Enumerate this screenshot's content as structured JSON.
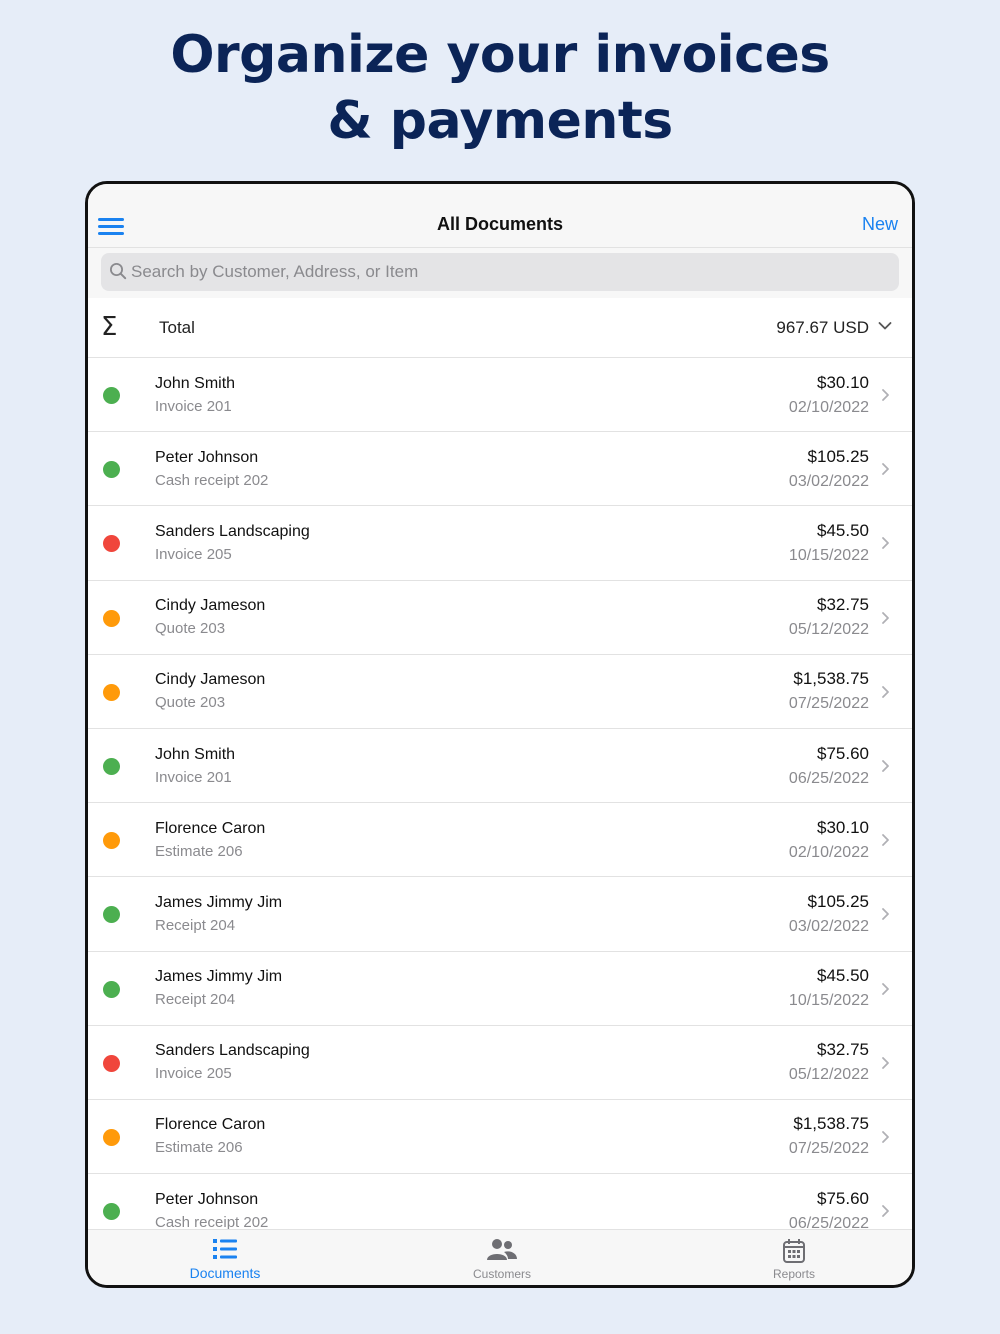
{
  "headline": {
    "line1": "Organize your invoices",
    "line2": "& payments"
  },
  "colors": {
    "accent": "#1a82f0",
    "status_paid": "#4caf50",
    "status_overdue": "#f0463c",
    "status_pending": "#ff9a0a"
  },
  "navbar": {
    "menu_icon": "hamburger-icon",
    "title": "All Documents",
    "new_label": "New"
  },
  "search": {
    "icon": "search-icon",
    "placeholder": "Search by Customer, Address, or Item"
  },
  "total": {
    "icon": "sigma-icon",
    "label": "Total",
    "value": "967.67 USD",
    "toggle_icon": "chevron-down-icon"
  },
  "documents": [
    {
      "name": "John Smith",
      "doc": "Invoice 201",
      "amount": "$30.10",
      "date": "02/10/2022",
      "status": "paid"
    },
    {
      "name": "Peter Johnson",
      "doc": "Cash receipt 202",
      "amount": "$105.25",
      "date": "03/02/2022",
      "status": "paid"
    },
    {
      "name": "Sanders Landscaping",
      "doc": "Invoice 205",
      "amount": "$45.50",
      "date": "10/15/2022",
      "status": "overdue"
    },
    {
      "name": "Cindy Jameson",
      "doc": "Quote 203",
      "amount": "$32.75",
      "date": "05/12/2022",
      "status": "pending"
    },
    {
      "name": "Cindy Jameson",
      "doc": "Quote 203",
      "amount": "$1,538.75",
      "date": "07/25/2022",
      "status": "pending"
    },
    {
      "name": "John Smith",
      "doc": "Invoice 201",
      "amount": "$75.60",
      "date": "06/25/2022",
      "status": "paid"
    },
    {
      "name": "Florence Caron",
      "doc": "Estimate 206",
      "amount": "$30.10",
      "date": "02/10/2022",
      "status": "pending"
    },
    {
      "name": "James Jimmy Jim",
      "doc": "Receipt 204",
      "amount": "$105.25",
      "date": "03/02/2022",
      "status": "paid"
    },
    {
      "name": "James Jimmy Jim",
      "doc": "Receipt 204",
      "amount": "$45.50",
      "date": "10/15/2022",
      "status": "paid"
    },
    {
      "name": "Sanders Landscaping",
      "doc": "Invoice 205",
      "amount": "$32.75",
      "date": "05/12/2022",
      "status": "overdue"
    },
    {
      "name": "Florence Caron",
      "doc": "Estimate 206",
      "amount": "$1,538.75",
      "date": "07/25/2022",
      "status": "pending"
    },
    {
      "name": "Peter Johnson",
      "doc": "Cash receipt 202",
      "amount": "$75.60",
      "date": "06/25/2022",
      "status": "paid"
    }
  ],
  "tabs": [
    {
      "label": "Documents",
      "icon": "list-icon",
      "active": true
    },
    {
      "label": "Customers",
      "icon": "people-icon",
      "active": false
    },
    {
      "label": "Reports",
      "icon": "calendar-icon",
      "active": false
    }
  ]
}
